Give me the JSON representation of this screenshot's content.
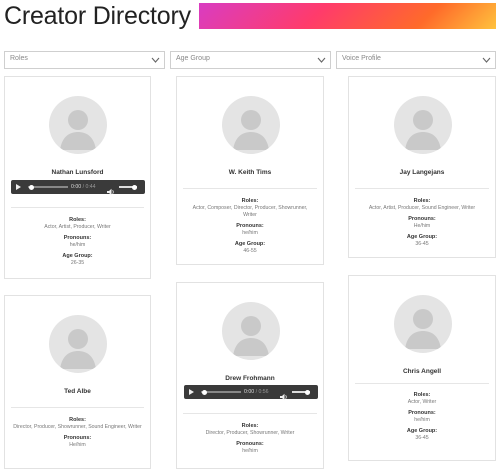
{
  "header": {
    "title": "Creator Directory"
  },
  "filters": {
    "roles": "Roles",
    "age_group": "Age Group",
    "voice_profile": "Voice Profile"
  },
  "labels": {
    "roles": "Roles:",
    "pronouns": "Pronouns:",
    "age_group": "Age Group:"
  },
  "creators": [
    {
      "name": "Nathan Lunsford",
      "roles": "Actor, Artist, Producer, Writer",
      "pronouns": "he/him",
      "age_group": "26-35",
      "audio": {
        "current": "0:00",
        "duration": "/ 0:44"
      }
    },
    {
      "name": "W. Keith Tims",
      "roles": "Actor, Composer, Director, Producer, Showrunner,",
      "roles_line2": "Writer",
      "pronouns": "he/him",
      "age_group": "46-55"
    },
    {
      "name": "Jay Langejans",
      "roles": "Actor, Artist, Producer, Sound Engineer, Writer",
      "pronouns": "He/him",
      "age_group": "36-45"
    },
    {
      "name": "Ted Albe",
      "roles": "Director, Producer, Showrunner, Sound Engineer, Writer",
      "pronouns": "He/him"
    },
    {
      "name": "Drew Frohmann",
      "roles": "Director, Producer, Showrunner, Writer",
      "pronouns": "he/him",
      "audio": {
        "current": "0:00",
        "duration": "/ 0:56"
      }
    },
    {
      "name": "Chris Angell",
      "roles": "Actor, Writer",
      "pronouns": "he/him",
      "age_group": "36-45"
    }
  ]
}
